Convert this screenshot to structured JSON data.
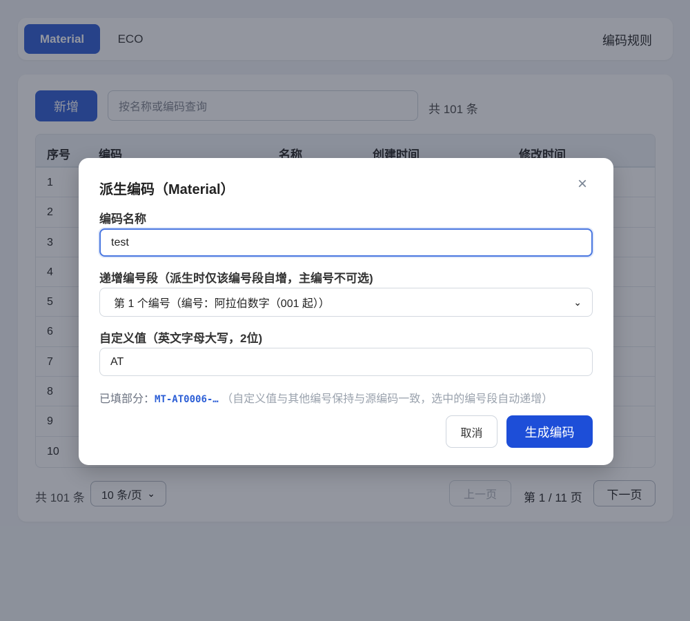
{
  "topbar": {
    "tabs": [
      {
        "label": "Material",
        "active": true
      },
      {
        "label": "ECO",
        "active": false
      }
    ],
    "rules_link": "编码规则"
  },
  "toolbar": {
    "add_label": "新增",
    "search_placeholder": "按名称或编码查询",
    "total": "共 101 条"
  },
  "table": {
    "columns": [
      "序号",
      "编码",
      "名称",
      "创建时间",
      "修改时间"
    ],
    "rows": [
      "1",
      "2",
      "3",
      "4",
      "5",
      "6",
      "7",
      "8",
      "9",
      "10"
    ]
  },
  "pager": {
    "total": "共 101 条",
    "page_size": "10 条/页",
    "prev_label": "上一页",
    "page_info": "第 1 / 11 页",
    "next_label": "下一页"
  },
  "modal": {
    "title": "派生编码（Material）",
    "close_icon": "×",
    "name_label": "编码名称",
    "name_value": "test",
    "segment_label": "递增编号段（派生时仅该编号段自增，主编号不可选)",
    "segment_value": "第 1 个编号（编号：阿拉伯数字（001 起））",
    "custom_label": "自定义值（英文字母大写，2位)",
    "custom_value": "AT",
    "filled_prefix": "已填部分：",
    "filled_code": "MT-AT0006-…",
    "filled_note": "（自定义值与其他编号保持与源编码一致，选中的编号段自动递增）",
    "cancel_label": "取消",
    "generate_label": "生成编码"
  },
  "colors": {
    "primary": "#1d4ed8",
    "tab_active": "#3b66d8",
    "overlay": "rgba(15,23,42,0.45)"
  }
}
